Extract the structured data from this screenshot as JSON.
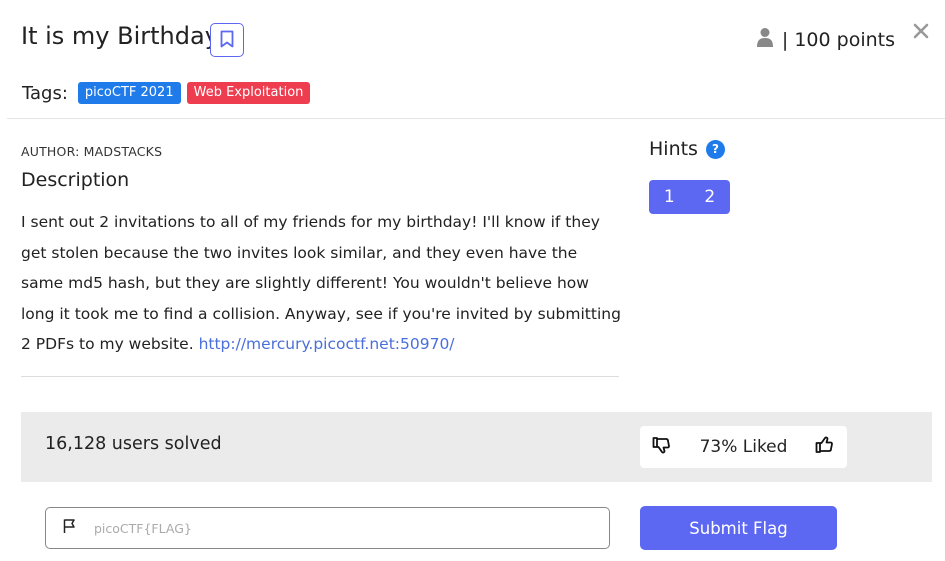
{
  "header": {
    "title": "It is my Birthday",
    "points": "| 100 points"
  },
  "tags": {
    "label": "Tags:",
    "items": [
      {
        "label": "picoCTF 2021",
        "color": "#1f7bea"
      },
      {
        "label": "Web Exploitation",
        "color": "#ef3d50"
      }
    ]
  },
  "description": {
    "author": "AUTHOR: MADSTACKS",
    "heading": "Description",
    "text": "I sent out 2 invitations to all of my friends for my birthday! I'll know if they get stolen because the two invites look similar, and they even have the same md5 hash, but they are slightly different! You wouldn't believe how long it took me to find a collision. Anyway, see if you're invited by submitting 2 PDFs to my website. ",
    "link": "http://mercury.picoctf.net:50970/"
  },
  "hints": {
    "heading": "Hints",
    "help_icon": "?",
    "items": [
      "1",
      "2"
    ]
  },
  "stats": {
    "solved": "16,128 users solved",
    "liked": "73% Liked"
  },
  "flag": {
    "placeholder": "picoCTF{FLAG}",
    "submit_label": "Submit Flag"
  },
  "colors": {
    "accent": "#5c67f2",
    "tag_blue": "#1f7bea",
    "tag_red": "#ef3d50"
  }
}
